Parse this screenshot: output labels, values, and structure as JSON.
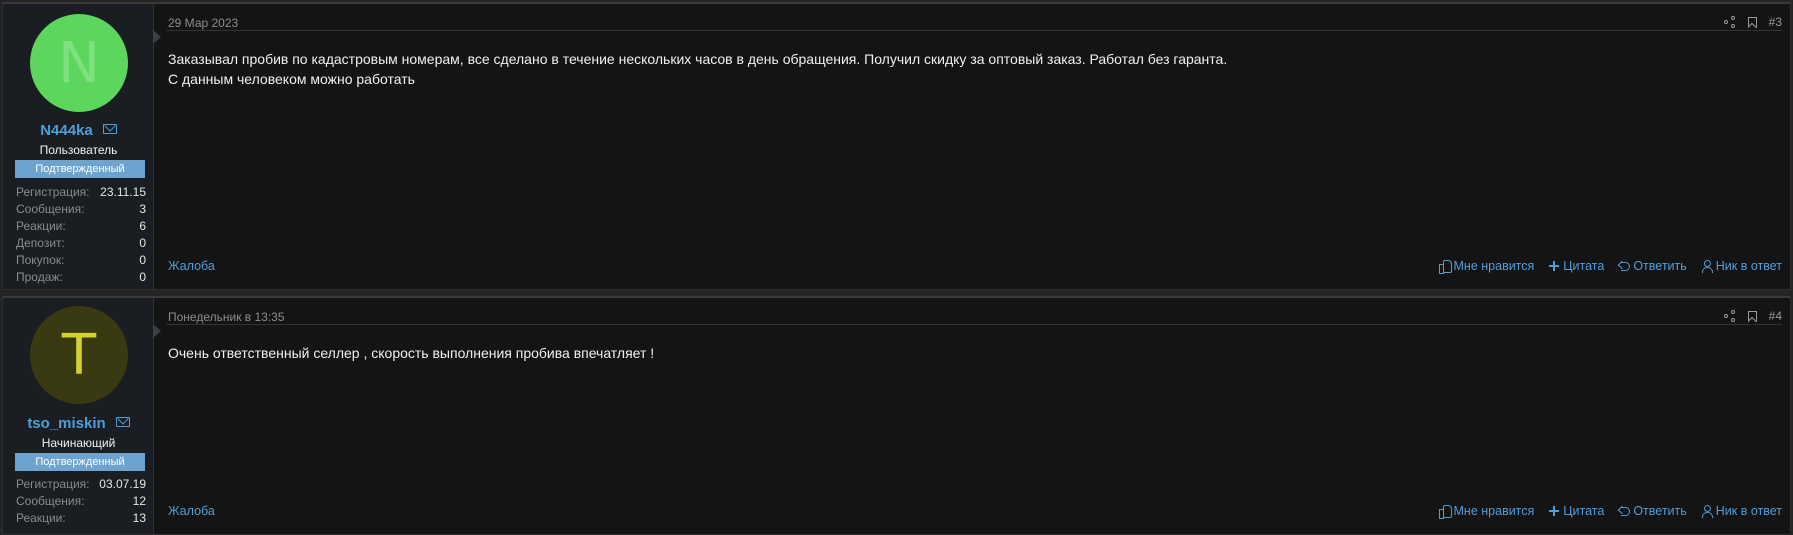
{
  "posts": [
    {
      "user": {
        "avatar_letter": "N",
        "avatar_color": "#5cd65c",
        "username": "N444ka",
        "role": "Пользователь",
        "badge": "Подтвержденный",
        "stats": [
          {
            "label": "Регистрация:",
            "value": "23.11.15"
          },
          {
            "label": "Сообщения:",
            "value": "3"
          },
          {
            "label": "Реакции:",
            "value": "6"
          },
          {
            "label": "Депозит:",
            "value": "0"
          },
          {
            "label": "Покупок:",
            "value": "0"
          },
          {
            "label": "Продаж:",
            "value": "0"
          }
        ]
      },
      "date": "29 Мар 2023",
      "number": "#3",
      "lines": [
        "Заказывал пробив по кадастровым номерам, все сделано в течение нескольких часов в день обращения. Получил скидку за оптовый заказ. Работал без гаранта.",
        "С данным человеком можно работать"
      ]
    },
    {
      "user": {
        "avatar_letter": "T",
        "avatar_color": "#3a3a12",
        "username": "tso_miskin",
        "role": "Начинающий",
        "badge": "Подтвержденный",
        "stats": [
          {
            "label": "Регистрация:",
            "value": "03.07.19"
          },
          {
            "label": "Сообщения:",
            "value": "12"
          },
          {
            "label": "Реакции:",
            "value": "13"
          }
        ]
      },
      "date": "Понедельник в 13:35",
      "number": "#4",
      "lines": [
        "Очень ответственный селлер , скорость выполнения пробива впечатляет !"
      ]
    }
  ],
  "actions": {
    "report": "Жалоба",
    "like": "Мне нравится",
    "quote": "Цитата",
    "reply": "Ответить",
    "nick": "Ник в ответ"
  }
}
